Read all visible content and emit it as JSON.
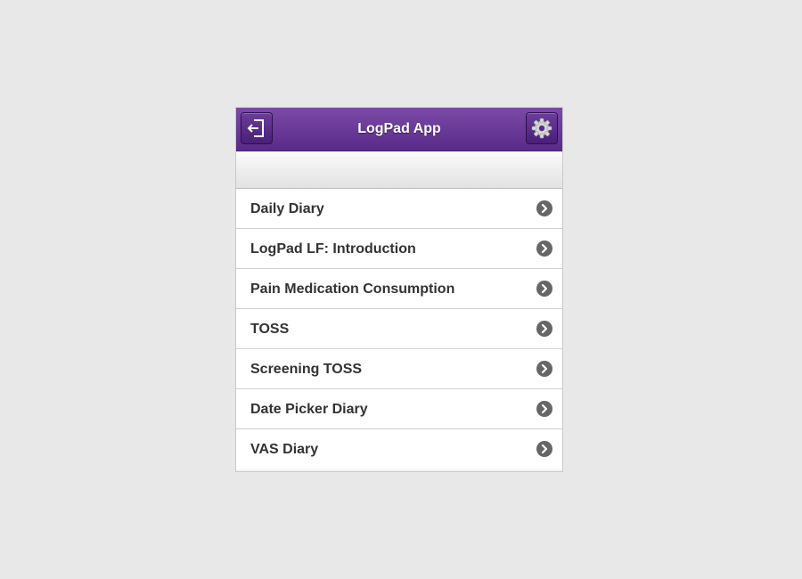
{
  "header": {
    "title": "LogPad App",
    "left_icon": "logout-icon",
    "right_icon": "gear-icon",
    "accent": "#5f2f8f"
  },
  "menu": {
    "items": [
      {
        "label": "Daily Diary",
        "icon": "chevron-right-circle-icon"
      },
      {
        "label": "LogPad LF: Introduction",
        "icon": "chevron-right-circle-icon"
      },
      {
        "label": "Pain Medication Consumption",
        "icon": "chevron-right-circle-icon"
      },
      {
        "label": "TOSS",
        "icon": "chevron-right-circle-icon"
      },
      {
        "label": "Screening TOSS",
        "icon": "chevron-right-circle-icon"
      },
      {
        "label": "Date Picker Diary",
        "icon": "chevron-right-circle-icon"
      },
      {
        "label": "VAS Diary",
        "icon": "chevron-right-circle-icon"
      }
    ]
  }
}
